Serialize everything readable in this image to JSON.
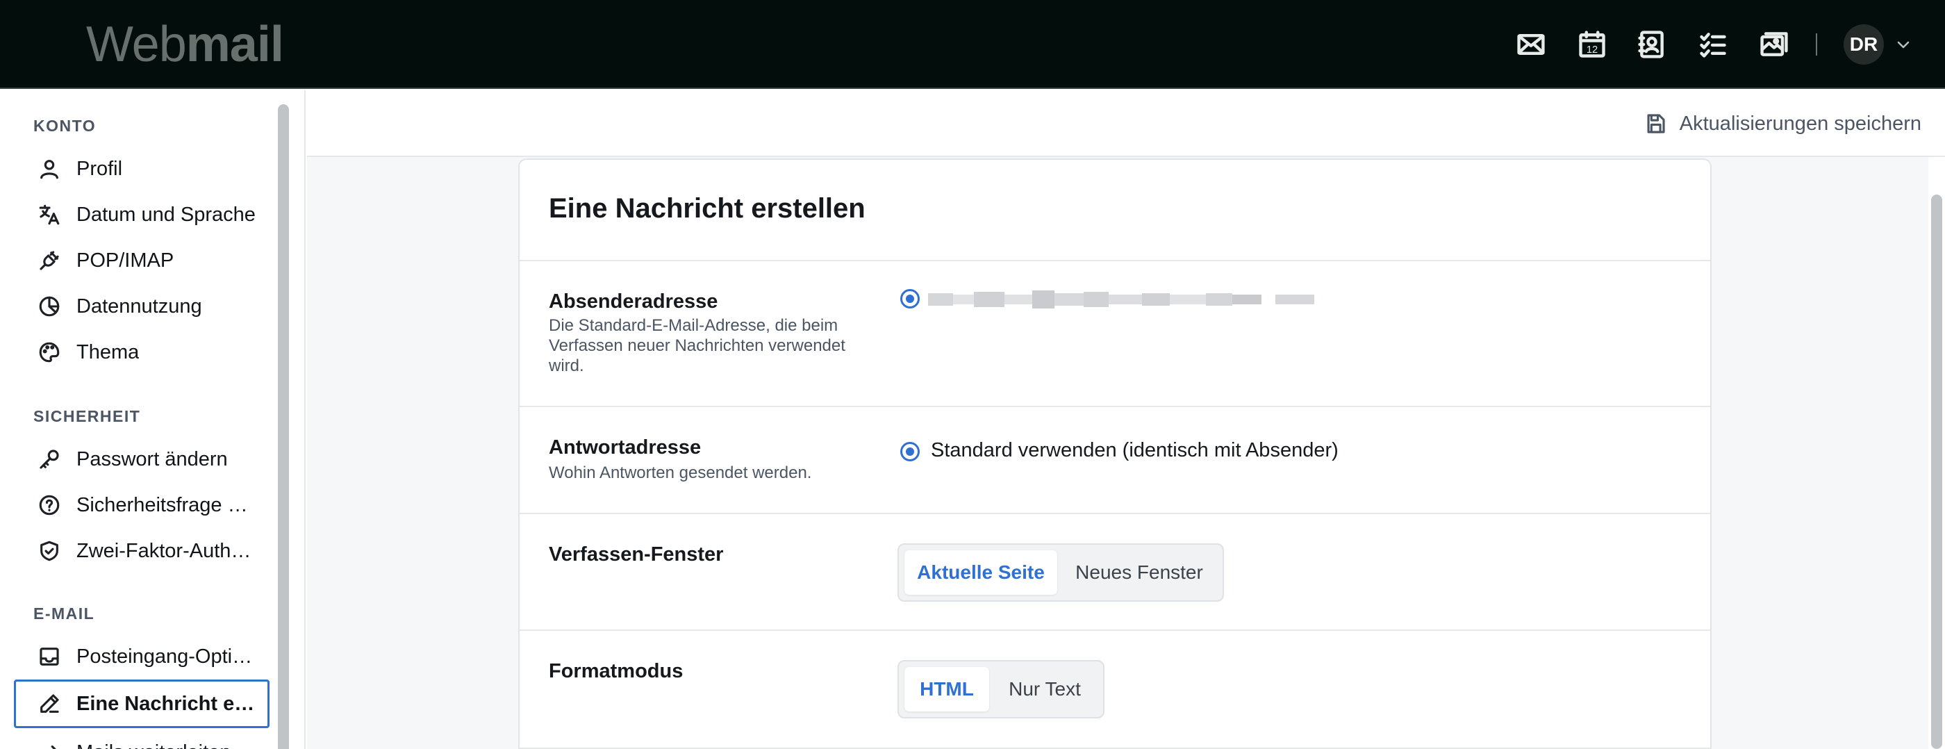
{
  "app": {
    "brand_light": "Web",
    "brand_bold": "mail",
    "user_initials": "DR"
  },
  "topbar_icons": [
    "mail-icon",
    "calendar-icon",
    "contacts-icon",
    "tasks-icon",
    "photos-icon"
  ],
  "calendar_day": "12",
  "sidebar": {
    "sections": [
      {
        "title": "KONTO",
        "items": [
          {
            "label": "Profil",
            "icon": "user-icon"
          },
          {
            "label": "Datum und Sprache",
            "icon": "language-icon"
          },
          {
            "label": "POP/IMAP",
            "icon": "plug-icon"
          },
          {
            "label": "Datennutzung",
            "icon": "pie-chart-icon"
          },
          {
            "label": "Thema",
            "icon": "palette-icon"
          }
        ]
      },
      {
        "title": "SICHERHEIT",
        "items": [
          {
            "label": "Passwort ändern",
            "icon": "key-icon"
          },
          {
            "label": "Sicherheitsfrage ändern",
            "icon": "question-icon"
          },
          {
            "label": "Zwei-Faktor-Authentifizierung",
            "icon": "shield-icon"
          }
        ]
      },
      {
        "title": "E-MAIL",
        "items": [
          {
            "label": "Posteingang-Optionen",
            "icon": "inbox-icon"
          },
          {
            "label": "Eine Nachricht erstellen",
            "icon": "pencil-icon",
            "active": true
          },
          {
            "label": "Mails weiterleiten",
            "icon": "forward-icon"
          }
        ]
      }
    ]
  },
  "toolbar": {
    "save_label": "Aktualisierungen speichern"
  },
  "page": {
    "title": "Eine Nachricht erstellen",
    "sender": {
      "label": "Absenderadresse",
      "description": "Die Standard-E-Mail-Adresse, die beim Verfassen neuer Nachrichten verwendet wird."
    },
    "reply": {
      "label": "Antwortadresse",
      "description": "Wohin Antworten gesendet werden.",
      "option": "Standard verwenden (identisch mit Absender)"
    },
    "compose_window": {
      "label": "Verfassen-Fenster",
      "options": [
        "Aktuelle Seite",
        "Neues Fenster"
      ],
      "selected": "Aktuelle Seite"
    },
    "format_mode": {
      "label": "Formatmodus",
      "options": [
        "HTML",
        "Nur Text"
      ],
      "selected": "HTML"
    }
  },
  "colors": {
    "accent": "#2e71d2",
    "topbar": "#030d0b"
  }
}
